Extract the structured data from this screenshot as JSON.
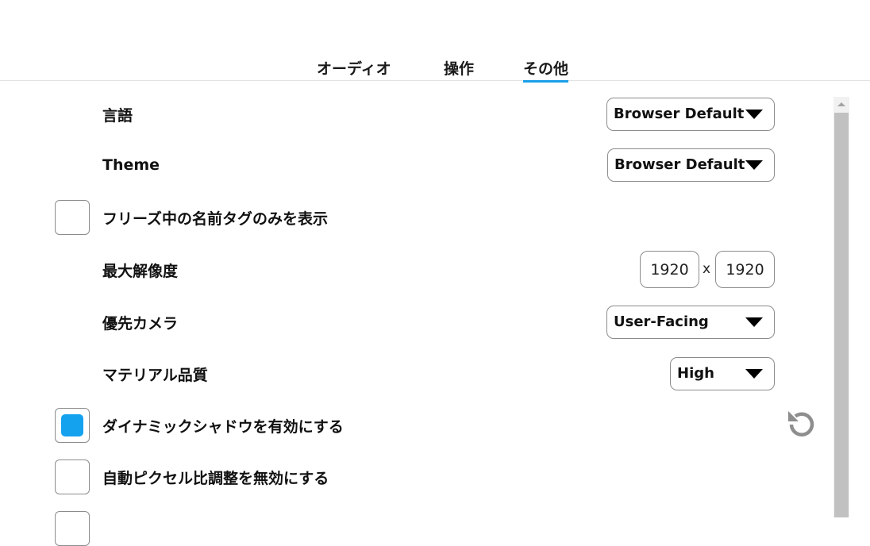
{
  "tabs": [
    {
      "label": "オーディオ"
    },
    {
      "label": "操作"
    },
    {
      "label": "その他",
      "active": true
    }
  ],
  "settings": {
    "language": {
      "label": "言語",
      "value": "Browser Default"
    },
    "theme": {
      "label": "Theme",
      "value": "Browser Default"
    },
    "freeze_nametags": {
      "label": "フリーズ中の名前タグのみを表示",
      "checked": false
    },
    "max_resolution": {
      "label": "最大解像度",
      "width": "1920",
      "separator": "x",
      "height": "1920"
    },
    "preferred_camera": {
      "label": "優先カメラ",
      "value": "User-Facing"
    },
    "material_quality": {
      "label": "マテリアル品質",
      "value": "High"
    },
    "dynamic_shadows": {
      "label": "ダイナミックシャドウを有効にする",
      "checked": true
    },
    "disable_pixel_ratio": {
      "label": "自動ピクセル比調整を無効にする",
      "checked": false
    }
  },
  "icons": {
    "reset": "reset-icon",
    "dropdown": "caret-down-icon"
  },
  "colors": {
    "accent": "#14a2ef",
    "tab_underline": "#1a9ee8",
    "scroll_thumb": "#c1c1c1"
  }
}
